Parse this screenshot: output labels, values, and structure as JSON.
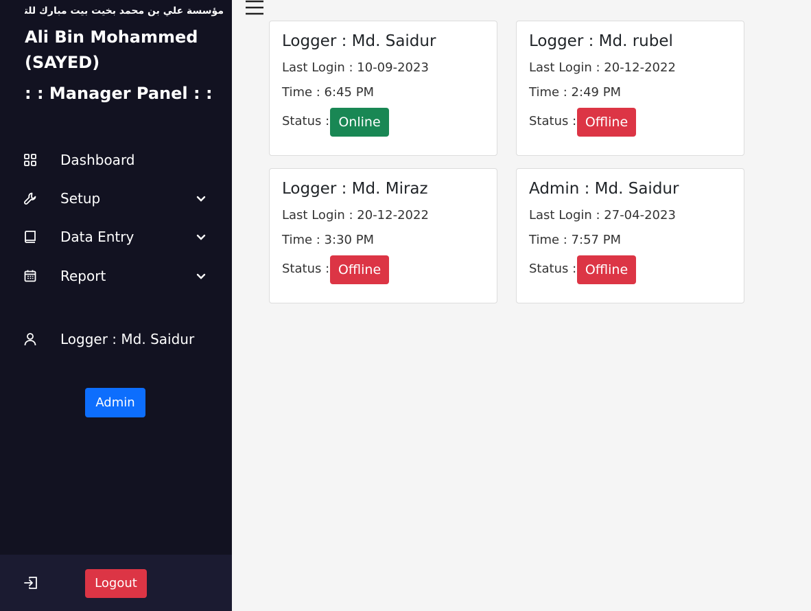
{
  "sidebar": {
    "arabic_name": "مؤسسة علي بن محمد بخيت بيت مبارك للتجارة",
    "company_name": "Ali Bin Mohammed (SAYED)",
    "panel_title": ": : Manager Panel : :",
    "nav": [
      {
        "label": "Dashboard",
        "icon": "grid-icon"
      },
      {
        "label": "Setup",
        "icon": "wrench-icon"
      },
      {
        "label": "Data Entry",
        "icon": "book-icon"
      },
      {
        "label": "Report",
        "icon": "calendar-icon"
      }
    ],
    "user_label": "Logger : Md. Saidur",
    "admin_button": "Admin",
    "logout_button": "Logout"
  },
  "cards": [
    {
      "title": "Logger : Md. Saidur",
      "last_login": "Last Login : 10-09-2023",
      "time": "Time : 6:45 PM",
      "status_label": "Status :",
      "status": "Online"
    },
    {
      "title": "Logger : Md. rubel",
      "last_login": "Last Login : 20-12-2022",
      "time": "Time : 2:49 PM",
      "status_label": "Status :",
      "status": "Offline"
    },
    {
      "title": "Logger : Md. Miraz",
      "last_login": "Last Login : 20-12-2022",
      "time": "Time : 3:30 PM",
      "status_label": "Status :",
      "status": "Offline"
    },
    {
      "title": "Admin : Md. Saidur",
      "last_login": "Last Login : 27-04-2023",
      "time": "Time : 7:57 PM",
      "status_label": "Status :",
      "status": "Offline"
    }
  ],
  "colors": {
    "sidebar_bg": "#121221",
    "online": "#198754",
    "offline": "#dc3545",
    "admin": "#0d6efd"
  }
}
